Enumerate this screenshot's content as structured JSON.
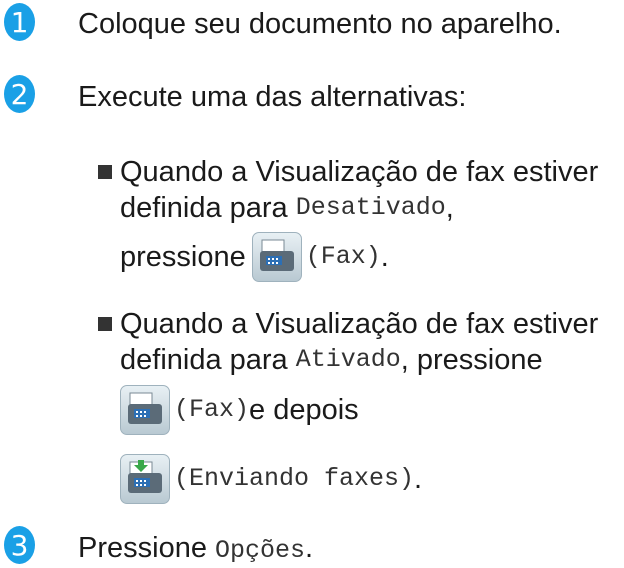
{
  "steps": [
    {
      "number": "1",
      "text": "Coloque seu documento no aparelho."
    },
    {
      "number": "2",
      "text": "Execute uma das alternativas:"
    },
    {
      "number": "3",
      "text_prefix": "Pressione ",
      "text_code": "Opções",
      "text_suffix": "."
    }
  ],
  "options": [
    {
      "line1": "Quando a Visualização de fax estiver",
      "line2_prefix": "definida para ",
      "line2_code": "Desativado",
      "line2_suffix": ",",
      "line3_prefix": "pressione",
      "icon": "fax-icon",
      "line3_code": "(Fax)",
      "line3_suffix": "."
    },
    {
      "line1": "Quando a Visualização de fax estiver",
      "line2_prefix": "definida para ",
      "line2_code": "Ativado",
      "line2_suffix": ", pressione",
      "icon1": "fax-icon",
      "line3_code": "(Fax)",
      "line3_suffix": " e depois",
      "icon2": "sending-fax-icon",
      "line4_code": "(Enviando faxes)",
      "line4_suffix": "."
    }
  ],
  "colors": {
    "step_badge": "#1aa0e6",
    "text": "#1a1a1a"
  }
}
